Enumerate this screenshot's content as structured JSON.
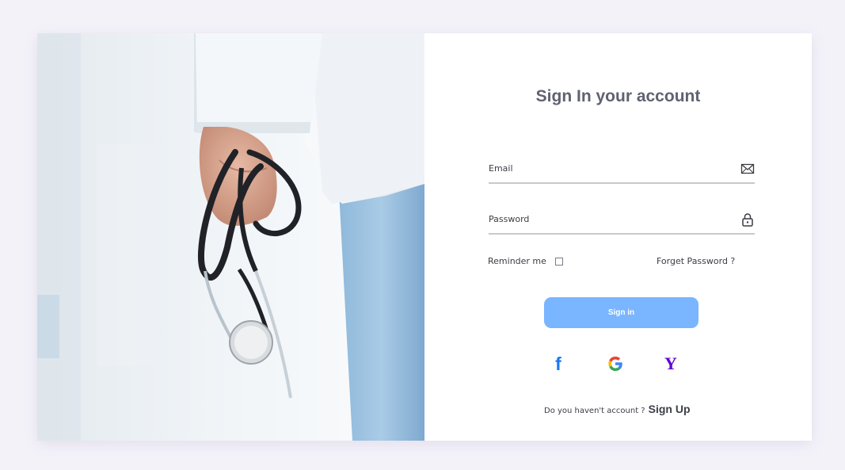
{
  "hero": {
    "image": "doctor-with-stethoscope"
  },
  "form": {
    "title": "Sign In your account",
    "email_label": "Email",
    "email_icon": "envelope-icon",
    "password_label": "Password",
    "password_icon": "lock-icon",
    "remember_label": "Reminder me",
    "remember_checked": false,
    "forgot_link": "Forget Password ?",
    "submit_label": "Sign in",
    "social": [
      "facebook-icon",
      "google-icon",
      "yahoo-icon"
    ],
    "footer_text": "Do you haven't account ?",
    "signup_link": "Sign Up"
  },
  "colors": {
    "background": "#f4f2f9",
    "button": "#7ab5ff",
    "title": "#5f6270",
    "facebook": "#1877f2",
    "yahoo": "#6001d2"
  }
}
